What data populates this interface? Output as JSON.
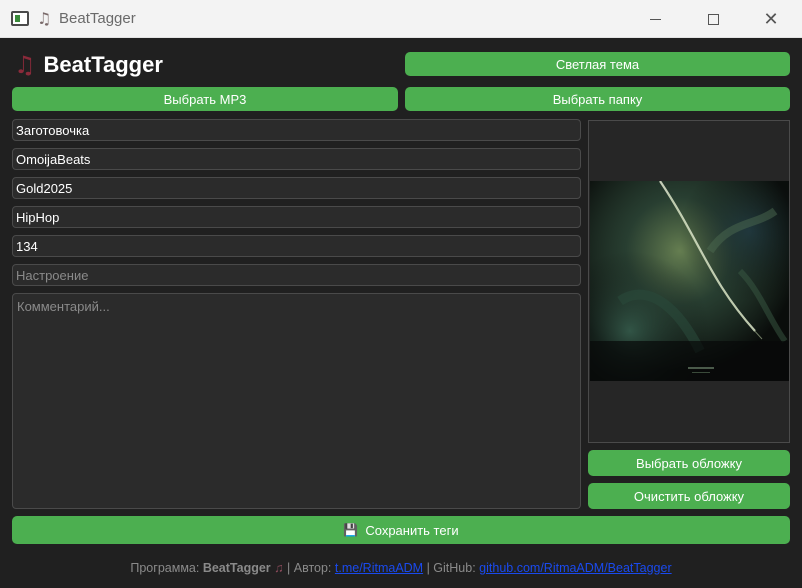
{
  "window": {
    "title": "BeatTagger"
  },
  "header": {
    "logo_icon": "♫",
    "logo_text": "BeatTagger",
    "theme_button": "Светлая тема"
  },
  "actions": {
    "select_mp3": "Выбрать MP3",
    "select_folder": "Выбрать папку"
  },
  "fields": {
    "title": "Заготовочка",
    "artist": "OmoijaBeats",
    "album": "Gold2025",
    "genre": "HipHop",
    "bpm": "134",
    "mood_placeholder": "Настроение",
    "comment_placeholder": "Комментарий..."
  },
  "cover": {
    "select_label": "Выбрать обложку",
    "clear_label": "Очистить обложку"
  },
  "save": {
    "icon": "💾",
    "label": "Сохранить теги"
  },
  "footer": {
    "program_prefix": "Программа:",
    "program_name": "BeatTagger",
    "note_icon": "♫",
    "author_prefix": "| Автор:",
    "author_link": "t.me/RitmaADM",
    "github_prefix": "| GitHub:",
    "github_link": "github.com/RitmaADM/BeatTagger"
  }
}
